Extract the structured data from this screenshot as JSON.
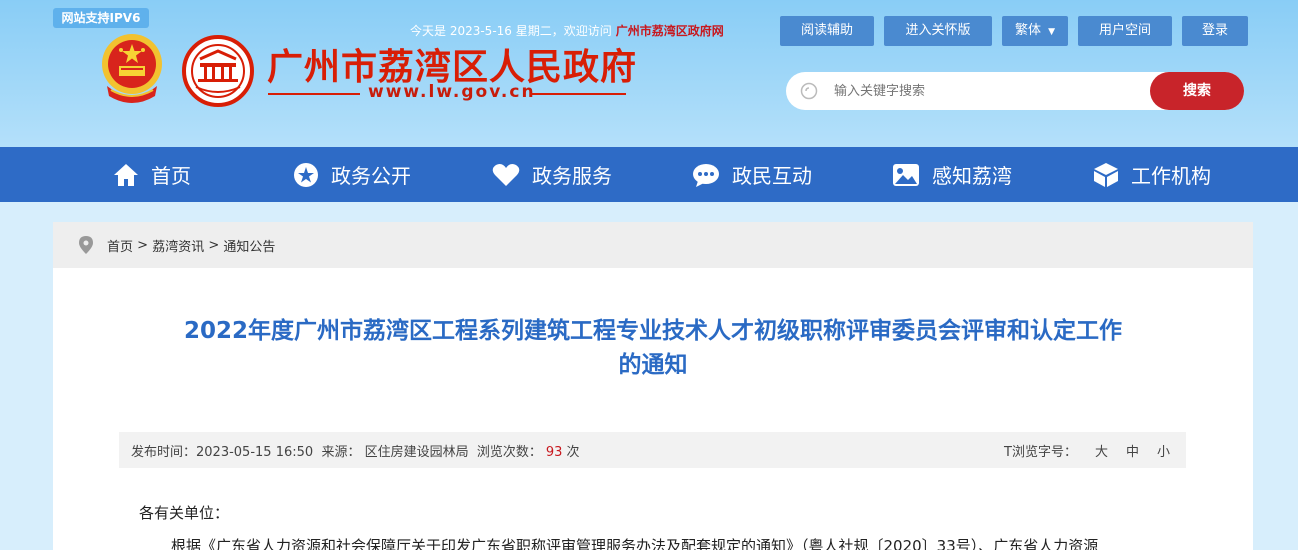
{
  "header": {
    "ipv6_badge": "网站支持IPV6",
    "site_name": "广州市荔湾区人民政府",
    "site_url": "www.lw.gov.cn",
    "welcome_text": "今天是 2023-5-16 星期二，欢迎访问",
    "welcome_link": "广州市荔湾区政府网",
    "buttons": {
      "reading_aid": "阅读辅助",
      "care_mode": "进入关怀版",
      "traditional": "繁体",
      "user_space": "用户空间",
      "login": "登录"
    },
    "search": {
      "placeholder": "输入关键字搜索",
      "button": "搜索"
    }
  },
  "nav": {
    "items": [
      {
        "label": "首页",
        "icon": "home-icon"
      },
      {
        "label": "政务公开",
        "icon": "star-icon"
      },
      {
        "label": "政务服务",
        "icon": "heart-icon"
      },
      {
        "label": "政民互动",
        "icon": "chat-icon"
      },
      {
        "label": "感知荔湾",
        "icon": "image-icon"
      },
      {
        "label": "工作机构",
        "icon": "cube-icon"
      }
    ]
  },
  "breadcrumb": [
    "首页",
    "荔湾资讯",
    "通知公告"
  ],
  "article": {
    "title_line1": "2022年度广州市荔湾区工程系列建筑工程专业技术人才初级职称评审委员会评审和认定工作",
    "title_line2": "的通知",
    "meta": {
      "publish_label": "发布时间：",
      "publish_time": "2023-05-15 16:50",
      "source_label": "来源：",
      "source": "区住房建设园林局",
      "views_label": "浏览次数：",
      "views": "93",
      "views_unit": "次",
      "font_size_label": "T浏览字号：",
      "size_large": "大",
      "size_medium": "中",
      "size_small": "小"
    },
    "salutation": "各有关单位：",
    "body_line1": "根据《广东省人力资源和社会保障厅关于印发广东省职称评审管理服务办法及配套规定的通知》（粤人社规〔2020〕33号）、广东省人力资源"
  },
  "colors": {
    "brand_red": "#d81e06",
    "nav_blue": "#2e6bc6",
    "title_blue": "#2a6ac4",
    "search_red": "#c8242a"
  }
}
